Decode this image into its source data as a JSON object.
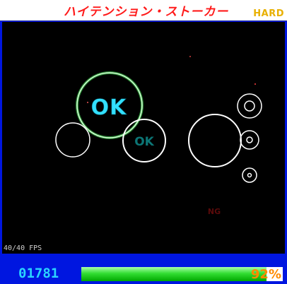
{
  "header": {
    "title": "ハイテンション・ストーカー",
    "difficulty": "HARD"
  },
  "playfield": {
    "fps_text": "40/40 FPS",
    "judgements": {
      "ok_big": "OK",
      "ok_small": "OK",
      "ng": "NG"
    }
  },
  "status": {
    "score": "01781",
    "gauge_value": 0.92,
    "gauge_text": "92%"
  },
  "colors": {
    "title_red": "#ff1a1a",
    "difficulty_yellow": "#e8b000",
    "frame_blue": "#0016e0",
    "score_cyan": "#2ad4ff",
    "ok_cyan": "#33e0ff",
    "ng_red": "#5a0a0a",
    "gauge_green": "#33dd33",
    "percent_orange": "#ff8a00"
  }
}
